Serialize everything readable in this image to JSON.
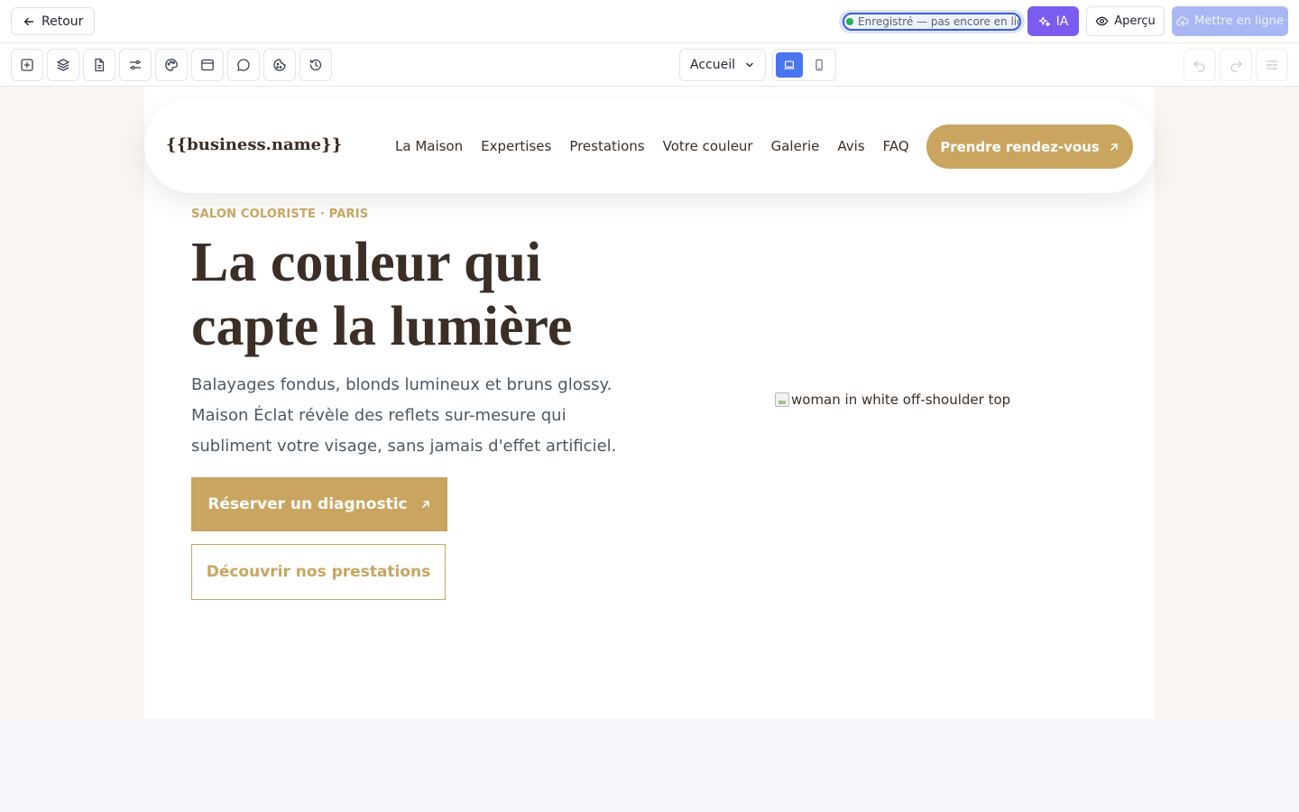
{
  "topbar": {
    "back_label": "Retour",
    "status": "Enregistré — pas encore en ligne",
    "ia_label": "IA",
    "preview_label": "Aperçu",
    "publish_label": "Mettre en ligne"
  },
  "toolbar": {
    "tools": [
      "add-section-icon",
      "layers-icon",
      "page-icon",
      "settings-sliders-icon",
      "palette-icon",
      "browser-window-icon",
      "chat-icon",
      "cookie-icon",
      "history-icon"
    ],
    "page_select": "Accueil",
    "devices": [
      "desktop-icon",
      "mobile-icon"
    ],
    "active_device": "desktop",
    "right_tools": [
      "undo-icon",
      "redo-icon",
      "adjustments-icon"
    ]
  },
  "site": {
    "logo": "{{business.name}}",
    "nav": [
      "La Maison",
      "Expertises",
      "Prestations",
      "Votre couleur",
      "Galerie",
      "Avis",
      "FAQ"
    ],
    "nav_cta": "Prendre rendez-vous",
    "hero": {
      "eyebrow": "SALON COLORISTE · PARIS",
      "title": "La couleur qui capte la lumière",
      "text": "Balayages fondus, blonds lumineux et bruns glossy. Maison Éclat révèle des reflets sur-mesure qui subliment votre visage, sans jamais d'effet artificiel.",
      "primary_cta": "Réserver un diagnostic",
      "secondary_cta": "Découvrir nos prestations",
      "image_alt": "woman in white off-shoulder top"
    }
  },
  "colors": {
    "accent_gold": "#c9a560",
    "dark_brown": "#3b2e26",
    "ia_purple": "#7b5cf0",
    "device_active_blue": "#4a74f0",
    "publish_disabled": "#a9b8f5"
  }
}
